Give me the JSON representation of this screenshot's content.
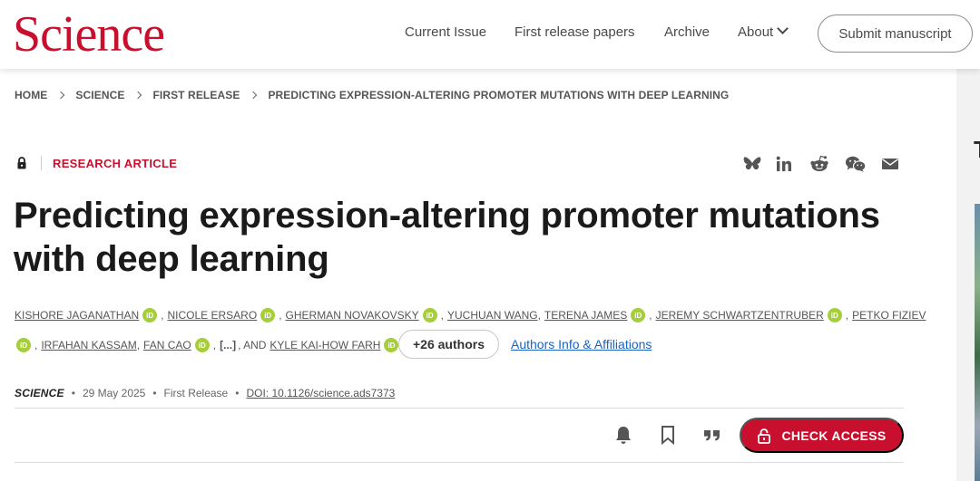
{
  "header": {
    "logo": "Science",
    "nav": [
      "Current Issue",
      "First release papers",
      "Archive",
      "About"
    ],
    "submit_label": "Submit manuscript"
  },
  "breadcrumb": [
    "HOME",
    "SCIENCE",
    "FIRST RELEASE",
    "PREDICTING EXPRESSION-ALTERING PROMOTER MUTATIONS WITH DEEP LEARNING"
  ],
  "article": {
    "type": "RESEARCH ARTICLE",
    "title": "Predicting expression-altering promoter mutations with deep learning",
    "authors_line1": [
      "KISHORE JAGANATHAN",
      "NICOLE ERSARO",
      "GHERMAN NOVAKOVSKY",
      "YUCHUAN WANG",
      "TERENA JAMES",
      "JEREMY SCHWARTZENTRUBER",
      "PETKO FIZIEV"
    ],
    "authors_line2": [
      "IRFAHAN KASSAM",
      "FAN CAO",
      "KYLE KAI-HOW FARH"
    ],
    "ellipsis": "[...]",
    "and_text": ", AND",
    "orcid_label": "iD",
    "more_authors": "+26 authors",
    "affiliations_link": "Authors Info & Affiliations"
  },
  "meta": {
    "journal": "SCIENCE",
    "date": "29 May 2025",
    "status": "First Release",
    "doi": "DOI: 10.1126/science.ads7373"
  },
  "share_icons": [
    "bluesky-icon",
    "linkedin-icon",
    "reddit-icon",
    "wechat-icon",
    "email-icon"
  ],
  "tools": {
    "check_access": "CHECK ACCESS"
  },
  "colors": {
    "brand_red": "#c8102e",
    "orcid_green": "#a6ce39",
    "link_blue": "#1a62c6"
  }
}
